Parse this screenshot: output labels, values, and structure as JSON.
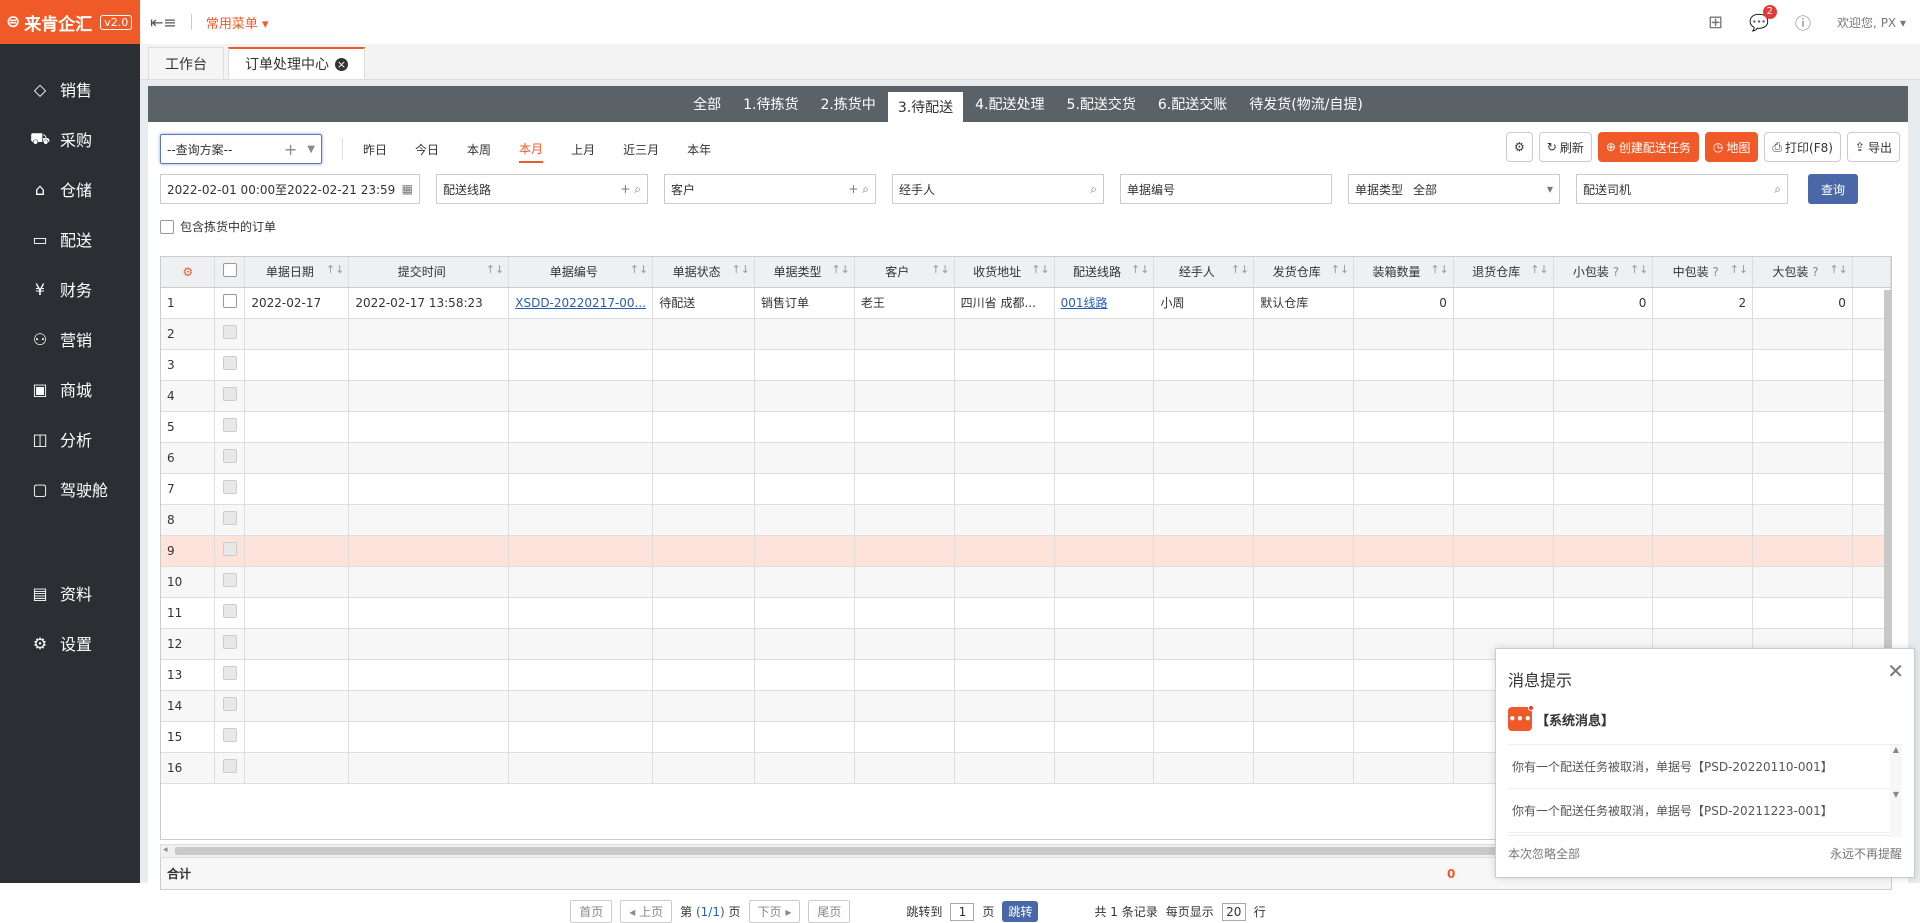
{
  "logo": {
    "text": "来肯企汇",
    "version": "v2.0"
  },
  "sidebar": {
    "main": [
      {
        "icon": "tag-icon",
        "label": "销售"
      },
      {
        "icon": "cart-icon",
        "label": "采购"
      },
      {
        "icon": "warehouse-icon",
        "label": "仓储"
      },
      {
        "icon": "truck-icon",
        "label": "配送"
      },
      {
        "icon": "yen-icon",
        "label": "财务"
      },
      {
        "icon": "megaphone-icon",
        "label": "营销"
      },
      {
        "icon": "store-icon",
        "label": "商城"
      },
      {
        "icon": "chart-icon",
        "label": "分析"
      },
      {
        "icon": "monitor-icon",
        "label": "驾驶舱"
      }
    ],
    "bottom": [
      {
        "icon": "archive-icon",
        "label": "资料"
      },
      {
        "icon": "gear-icon",
        "label": "设置"
      }
    ]
  },
  "topbar": {
    "common_menu": "常用菜单",
    "notification_count": "2",
    "greeting": "欢迎您,",
    "user": "PX"
  },
  "tabs": [
    {
      "label": "工作台"
    },
    {
      "label": "订单处理中心"
    }
  ],
  "status_tabs": [
    "全部",
    "1.待拣货",
    "2.拣货中",
    "3.待配送",
    "4.配送处理",
    "5.配送交货",
    "6.配送交账",
    "待发货(物流/自提)"
  ],
  "filters": {
    "scheme_placeholder": "--查询方案--",
    "periods": [
      "昨日",
      "今日",
      "本周",
      "本月",
      "上月",
      "近三月",
      "本年"
    ],
    "date_range": "2022-02-01 00:00至2022-02-21 23:59",
    "route": "配送线路",
    "customer": "客户",
    "handler": "经手人",
    "doc_no": "单据编号",
    "doc_type_label": "单据类型",
    "doc_type_value": "全部",
    "driver": "配送司机",
    "query_button": "查询",
    "include_picking": "包含拣货中的订单"
  },
  "toolbar": {
    "refresh": "刷新",
    "create_task": "创建配送任务",
    "map": "地图",
    "print": "打印(F8)",
    "export": "导出"
  },
  "table": {
    "columns": [
      "单据日期",
      "提交时间",
      "单据编号",
      "单据状态",
      "单据类型",
      "客户",
      "收货地址",
      "配送线路",
      "经手人",
      "发货仓库",
      "装箱数量",
      "退货仓库",
      "小包装",
      "中包装",
      "大包装"
    ],
    "rows": [
      {
        "idx": "1",
        "date": "2022-02-17",
        "submit": "2022-02-17 13:58:23",
        "doc": "XSDD-20220217-00...",
        "status": "待配送",
        "type": "销售订单",
        "customer": "老王",
        "address": "四川省 成都...",
        "route": "001线路",
        "handler": "小周",
        "warehouse": "默认仓库",
        "boxes": "0",
        "return_wh": "",
        "small": "0",
        "medium": "2",
        "large": "0"
      }
    ],
    "empty_rows": [
      "2",
      "3",
      "4",
      "5",
      "6",
      "7",
      "8",
      "9",
      "10",
      "11",
      "12",
      "13",
      "14",
      "15",
      "16"
    ],
    "total_label": "合计",
    "total_boxes": "0"
  },
  "pager": {
    "first": "首页",
    "prev": "上页",
    "page_info_a": "第",
    "page_info_b": "(1/1)",
    "page_info_c": "页",
    "next": "下页",
    "last": "尾页",
    "jump_to": "跳转到",
    "jump_page": "1",
    "page_word": "页",
    "jump": "跳转",
    "records": "共 1 条记录",
    "per_page": "每页显示",
    "per_page_value": "20",
    "row_word": "行"
  },
  "popup": {
    "title": "消息提示",
    "system": "【系统消息】",
    "messages": [
      "你有一个配送任务被取消，单据号【PSD-20220110-001】",
      "你有一个配送任务被取消，单据号【PSD-20211223-001】"
    ],
    "ignore": "本次忽略全部",
    "never": "永远不再提醒"
  }
}
